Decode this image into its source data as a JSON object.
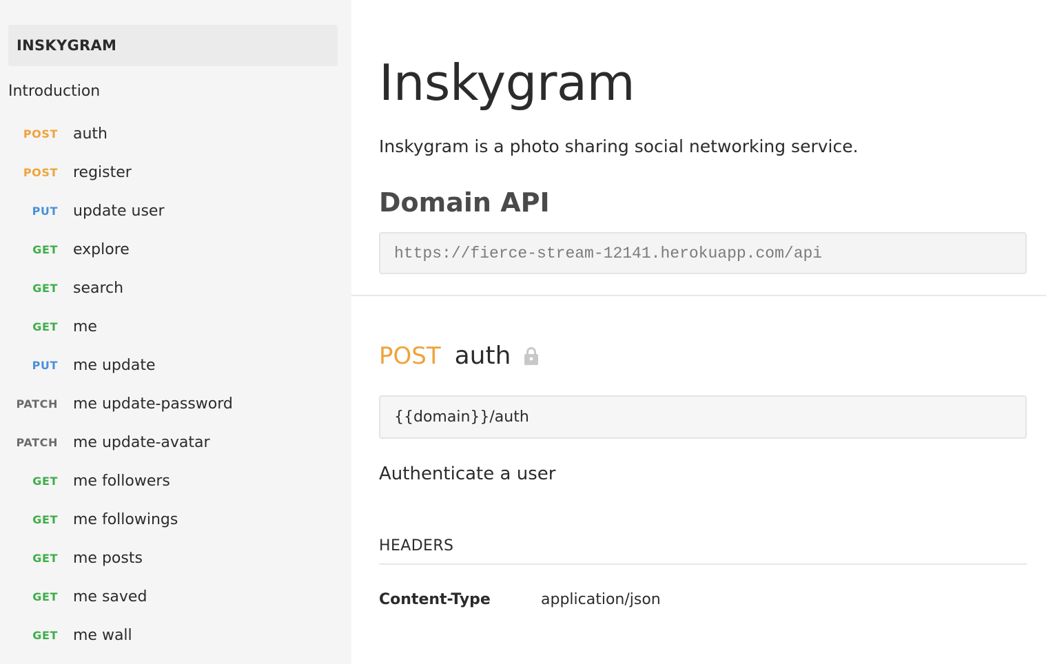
{
  "sidebar": {
    "collection_name": "INSKYGRAM",
    "section_title": "Introduction",
    "items": [
      {
        "method": "POST",
        "label": "auth"
      },
      {
        "method": "POST",
        "label": "register"
      },
      {
        "method": "PUT",
        "label": "update user"
      },
      {
        "method": "GET",
        "label": "explore"
      },
      {
        "method": "GET",
        "label": "search"
      },
      {
        "method": "GET",
        "label": "me"
      },
      {
        "method": "PUT",
        "label": "me update"
      },
      {
        "method": "PATCH",
        "label": "me update-password"
      },
      {
        "method": "PATCH",
        "label": "me update-avatar"
      },
      {
        "method": "GET",
        "label": "me followers"
      },
      {
        "method": "GET",
        "label": "me followings"
      },
      {
        "method": "GET",
        "label": "me posts"
      },
      {
        "method": "GET",
        "label": "me saved"
      },
      {
        "method": "GET",
        "label": "me wall"
      }
    ]
  },
  "main": {
    "title": "Inskygram",
    "description": "Inskygram is a photo sharing social networking service.",
    "domain_heading": "Domain API",
    "domain_url": "https://fierce-stream-12141.herokuapp.com/api",
    "request": {
      "method": "POST",
      "name": "auth",
      "lock_icon": "lock-icon",
      "url": "{{domain}}/auth",
      "description": "Authenticate a user",
      "headers_title": "HEADERS",
      "headers": [
        {
          "key": "Content-Type",
          "value": "application/json"
        }
      ]
    }
  },
  "colors": {
    "post": "#eea33a",
    "put": "#4a90d9",
    "get": "#3cae48",
    "patch": "#6b6b6b",
    "sidebar_bg": "#f5f5f5"
  }
}
